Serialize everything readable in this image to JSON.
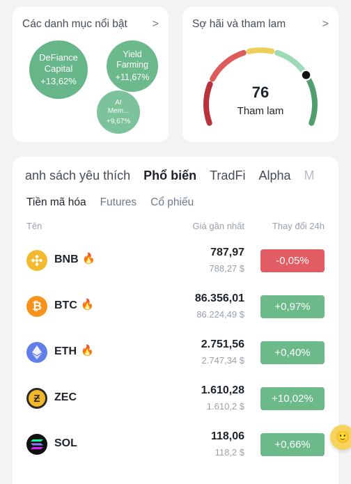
{
  "categories_card": {
    "title": "Các danh mục nổi bật",
    "chevron": ">",
    "bubbles": [
      {
        "name": "DeFiance Capital",
        "name_l1": "DeFiance",
        "name_l2": "Capital",
        "change": "+13,62%"
      },
      {
        "name": "Yield Farming",
        "name_l1": "Yield",
        "name_l2": "Farming",
        "change": "+11,67%"
      },
      {
        "name": "AI Mem...",
        "name_l1": "AI",
        "name_l2": "Mem...",
        "change": "+9,67%"
      }
    ]
  },
  "fear_greed_card": {
    "title": "Sợ hãi và tham lam",
    "chevron": ">",
    "value": "76",
    "label": "Tham lam",
    "index_value": 76,
    "segment_colors": [
      "#b7323a",
      "#dd5b5a",
      "#eecf5b",
      "#9fdab6",
      "#4f9e6c"
    ]
  },
  "market": {
    "tabs": [
      "anh sách yêu thích",
      "Phổ biến",
      "TradFi",
      "Alpha",
      "M"
    ],
    "active_tab": "Phổ biến",
    "subtabs": [
      "Tiền mã hóa",
      "Futures",
      "Cổ phiếu"
    ],
    "active_subtab": "Tiền mã hóa",
    "columns": {
      "name": "Tên",
      "price": "Giá gần nhất",
      "change": "Thay đổi 24h"
    },
    "rows": [
      {
        "symbol": "BNB",
        "hot": true,
        "price": "787,97",
        "price_sub": "788,27 $",
        "change": "-0,05%",
        "direction": "down",
        "icon": "bnb-icon",
        "icon_color": "#f3ba2f"
      },
      {
        "symbol": "BTC",
        "hot": true,
        "price": "86.356,01",
        "price_sub": "86.224,49 $",
        "change": "+0,97%",
        "direction": "up",
        "icon": "btc-icon",
        "icon_color": "#f7931a"
      },
      {
        "symbol": "ETH",
        "hot": true,
        "price": "2.751,56",
        "price_sub": "2.747,34 $",
        "change": "+0,40%",
        "direction": "up",
        "icon": "eth-icon",
        "icon_color": "#627eea"
      },
      {
        "symbol": "ZEC",
        "hot": false,
        "price": "1.610,28",
        "price_sub": "1.610,2 $",
        "change": "+10,02%",
        "direction": "up",
        "icon": "zec-icon",
        "icon_color": "#2b2b2b"
      },
      {
        "symbol": "SOL",
        "hot": false,
        "price": "118,06",
        "price_sub": "118,2 $",
        "change": "+0,66%",
        "direction": "up",
        "icon": "sol-icon",
        "icon_color": "#111111"
      }
    ]
  },
  "colors": {
    "up": "#6cb98a",
    "down": "#e15d63",
    "bubble": "#67b68a"
  }
}
